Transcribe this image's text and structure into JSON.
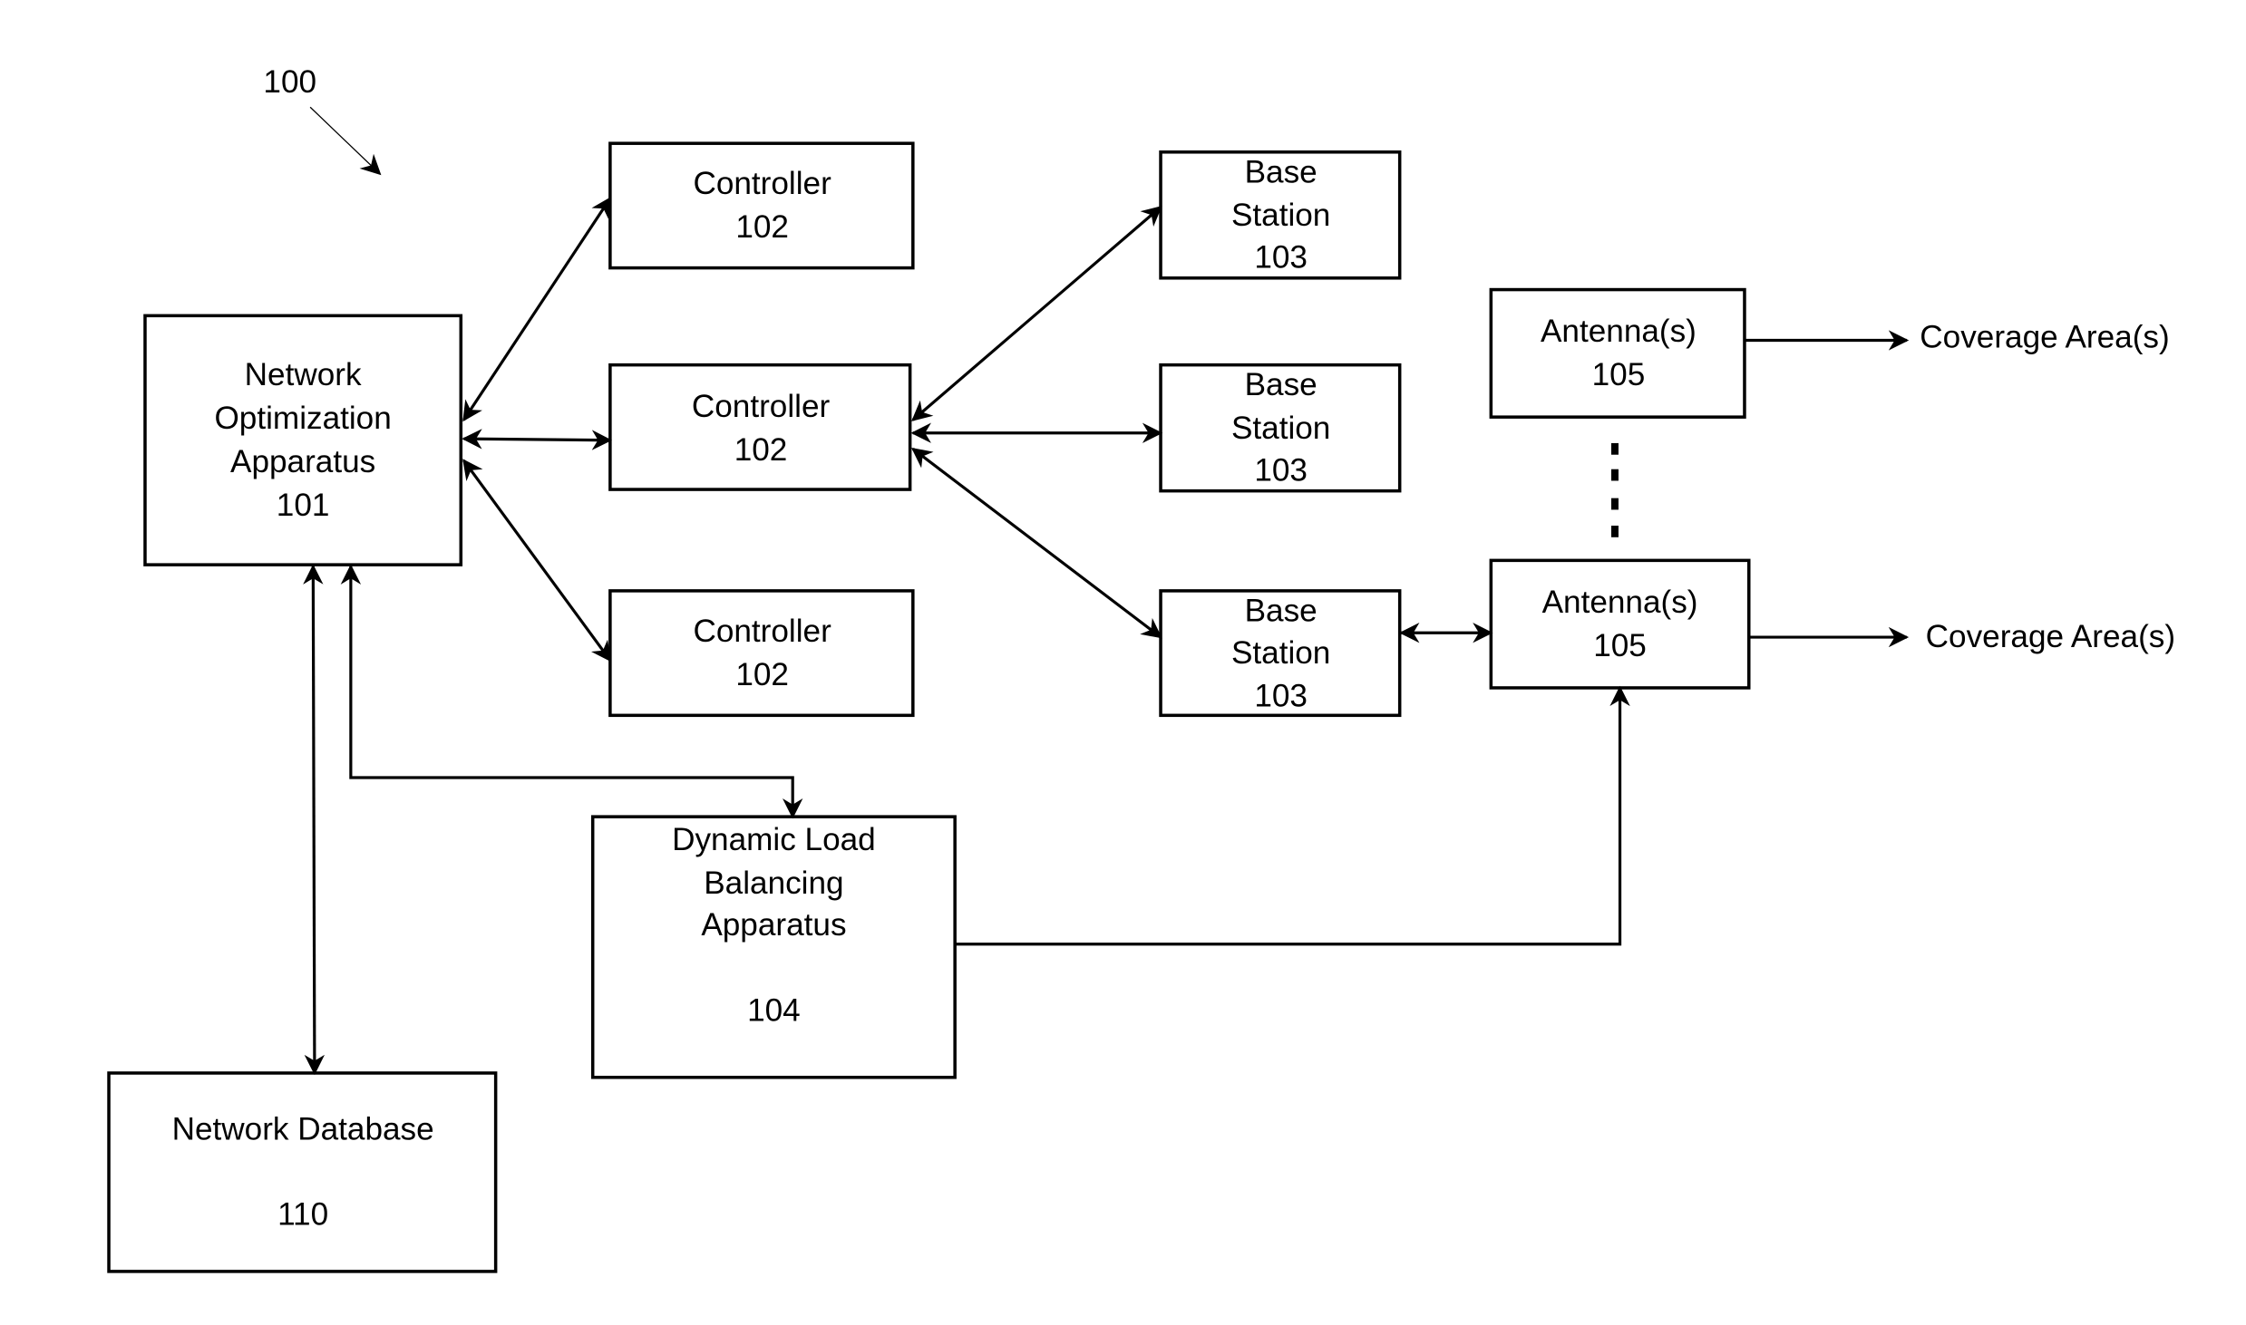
{
  "figure": {
    "reference_label": "100"
  },
  "nodes": {
    "network_optimization": {
      "lines": [
        "Network",
        "Optimization",
        "Apparatus",
        "101"
      ]
    },
    "controller_top": {
      "lines": [
        "Controller",
        "102"
      ]
    },
    "controller_mid": {
      "lines": [
        "Controller",
        "102"
      ]
    },
    "controller_bottom": {
      "lines": [
        "Controller",
        "102"
      ]
    },
    "base_station_top": {
      "lines": [
        "Base",
        "Station",
        "103"
      ]
    },
    "base_station_mid": {
      "lines": [
        "Base",
        "Station",
        "103"
      ]
    },
    "base_station_bottom": {
      "lines": [
        "Base",
        "Station",
        "103"
      ]
    },
    "antenna_top": {
      "lines": [
        "Antenna(s)",
        "105"
      ]
    },
    "antenna_bottom": {
      "lines": [
        "Antenna(s)",
        "105"
      ]
    },
    "load_balancing": {
      "lines": [
        "Dynamic Load",
        "Balancing",
        "Apparatus",
        "",
        "104"
      ]
    },
    "network_database": {
      "lines": [
        "Network Database",
        "",
        "110"
      ]
    }
  },
  "outputs": {
    "coverage_top": "Coverage Area(s)",
    "coverage_bottom": "Coverage Area(s)"
  },
  "edges": [
    {
      "from": "network_optimization",
      "to": "controller_top",
      "direction": "bidirectional"
    },
    {
      "from": "network_optimization",
      "to": "controller_mid",
      "direction": "bidirectional"
    },
    {
      "from": "network_optimization",
      "to": "controller_bottom",
      "direction": "bidirectional"
    },
    {
      "from": "controller_mid",
      "to": "base_station_top",
      "direction": "bidirectional"
    },
    {
      "from": "controller_mid",
      "to": "base_station_mid",
      "direction": "bidirectional"
    },
    {
      "from": "controller_mid",
      "to": "base_station_bottom",
      "direction": "bidirectional"
    },
    {
      "from": "base_station_bottom",
      "to": "antenna_bottom",
      "direction": "bidirectional"
    },
    {
      "from": "antenna_top",
      "to": "coverage_top",
      "direction": "forward"
    },
    {
      "from": "antenna_bottom",
      "to": "coverage_bottom",
      "direction": "forward"
    },
    {
      "from": "network_optimization",
      "to": "network_database",
      "direction": "bidirectional"
    },
    {
      "from": "network_optimization",
      "to": "load_balancing",
      "direction": "bidirectional"
    },
    {
      "from": "load_balancing",
      "to": "antenna_bottom",
      "direction": "forward"
    }
  ]
}
